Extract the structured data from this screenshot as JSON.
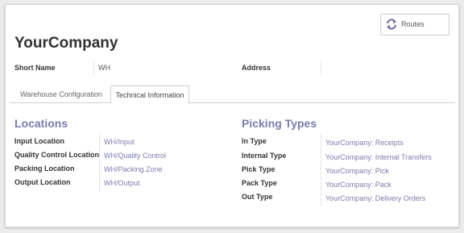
{
  "routes_button": {
    "label": "Routes",
    "icon": "refresh-arrows-icon",
    "icon_color": "#6b6ba8"
  },
  "company_name": "YourCompany",
  "short_name": {
    "label": "Short Name",
    "value": "WH"
  },
  "address": {
    "label": "Address",
    "value": ""
  },
  "tabs": [
    {
      "label": "Warehouse Configuration",
      "active": false
    },
    {
      "label": "Technical Information",
      "active": true
    }
  ],
  "locations": {
    "title": "Locations",
    "rows": [
      {
        "label": "Input Location",
        "value": "WH/Input"
      },
      {
        "label": "Quality Control Location",
        "value": "WH/Quality Control"
      },
      {
        "label": "Packing Location",
        "value": "WH/Packing Zone"
      },
      {
        "label": "Output Location",
        "value": "WH/Output"
      }
    ]
  },
  "picking_types": {
    "title": "Picking Types",
    "rows": [
      {
        "label": "In Type",
        "value": "YourCompany: Receipts"
      },
      {
        "label": "Internal Type",
        "value": "YourCompany: Internal Transfers"
      },
      {
        "label": "Pick Type",
        "value": "YourCompany: Pick"
      },
      {
        "label": "Pack Type",
        "value": "YourCompany: Pack"
      },
      {
        "label": "Out Type",
        "value": "YourCompany: Delivery Orders"
      }
    ]
  },
  "colors": {
    "accent": "#7c7bad",
    "label": "#333333",
    "background": "#ececec"
  }
}
